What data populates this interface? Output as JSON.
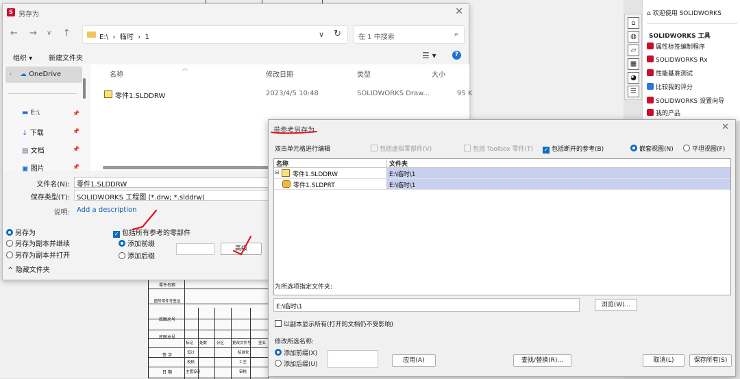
{
  "background": {
    "title_block": {
      "rows": [
        "零件名称",
        "图号零件号签证",
        "底图总号",
        "底图总号",
        "签 字",
        "日 期"
      ],
      "headers": [
        "标记",
        "处数",
        "分区",
        "更改文件号",
        "签名"
      ],
      "design": "设计",
      "check": "校核",
      "standard": "标准化",
      "process": "工艺",
      "approve": "审核",
      "main_design": "主管设计"
    }
  },
  "task_pane": {
    "welcome": "欢迎使用 SOLIDWORKS",
    "tools_header": "SOLIDWORKS 工具",
    "items": [
      "属性标签编制程序",
      "SOLIDWORKS Rx",
      "性能基准测试",
      "比较我的评分",
      "SOLIDWORKS 设置向导",
      "我的产品"
    ],
    "colors": {
      "accent": "#c8102e",
      "link": "#222222"
    }
  },
  "save_as": {
    "title": "另存为",
    "address": "E:\\  ›  临时  ›  1",
    "address_prefix": "›",
    "search_placeholder": "在 1 中搜索",
    "toolbar": {
      "organize": "组织 ▾",
      "new_folder": "新建文件夹"
    },
    "nav": {
      "onedrive": "OneDrive",
      "items": [
        "E:\\",
        "下载",
        "文档",
        "图片"
      ]
    },
    "columns": [
      "名称",
      "修改日期",
      "类型",
      "大小"
    ],
    "file": {
      "name": "零件1.SLDDRW",
      "date": "2023/4/5 10:48",
      "type": "SOLIDWORKS Draw...",
      "size": "95 K"
    },
    "filename_label": "文件名(N):",
    "filename_value": "零件1.SLDDRW",
    "filetype_label": "保存类型(T):",
    "filetype_value": "SOLIDWORKS 工程图 (*.drw; *.slddrw)",
    "desc_label": "说明:",
    "desc_link": "Add a description",
    "options": [
      "另存为",
      "另存为副本并继续",
      "另存为副本并打开"
    ],
    "include_refs": "包括所有参考的零部件",
    "prefix": "添加前缀",
    "suffix": "添加后缀",
    "advanced": "高级",
    "hide_folders": "隐藏文件夹"
  },
  "ref_dialog": {
    "title": "带参考另存为",
    "dbl_click": "双击单元格进行编辑",
    "include_virtual": "包括虚拟零部件(V)",
    "include_toolbox": "包括 Toolbox 零件(T)",
    "include_broken": "包括断开的参考(B)",
    "nested_view": "嵌套视图(N)",
    "flat_view": "平坦视图(F)",
    "grid_headers": [
      "名称",
      "文件夹"
    ],
    "rows": [
      {
        "name": "零件1.SLDDRW",
        "folder": "E:\\临时\\1"
      },
      {
        "name": "零件1.SLDPRT",
        "folder": "E:\\临时\\1"
      }
    ],
    "folder_label": "为所选项指定文件夹:",
    "folder_value": "E:\\临时\\1",
    "browse": "浏览(W)...",
    "show_all": "以副本显示所有(打开的文档仍不受影响)",
    "rename_label": "修改所选名称:",
    "add_prefix": "添加前缀(X)",
    "add_suffix": "添加后缀(U)",
    "apply": "应用(A)",
    "find_replace": "查找/替换(R)...",
    "cancel": "取消(L)",
    "save_all": "保存所有(S)"
  },
  "colors": {
    "selection": "#c8d0f0",
    "primary": "#0f6cbd",
    "annotation": "#e0141e"
  }
}
